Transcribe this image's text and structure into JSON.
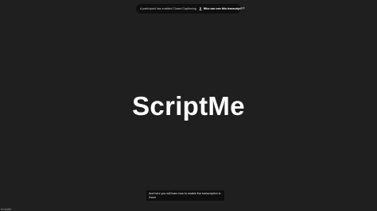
{
  "notification": {
    "message": "A participant has enabled Closed Captioning",
    "link_label": "Who can see this transcript?",
    "link_icon": "person-icon",
    "close_label": "×"
  },
  "brand": {
    "title": "ScriptMe"
  },
  "caption": {
    "text": "And here you will learn how to enable live transcription in Zoom"
  },
  "footer": {
    "label": "ScriptMe"
  },
  "colors": {
    "background": "#1f1f1f",
    "notice_background": "#0f0f0f",
    "caption_background": "#0e0e0e",
    "text": "#ffffff"
  }
}
